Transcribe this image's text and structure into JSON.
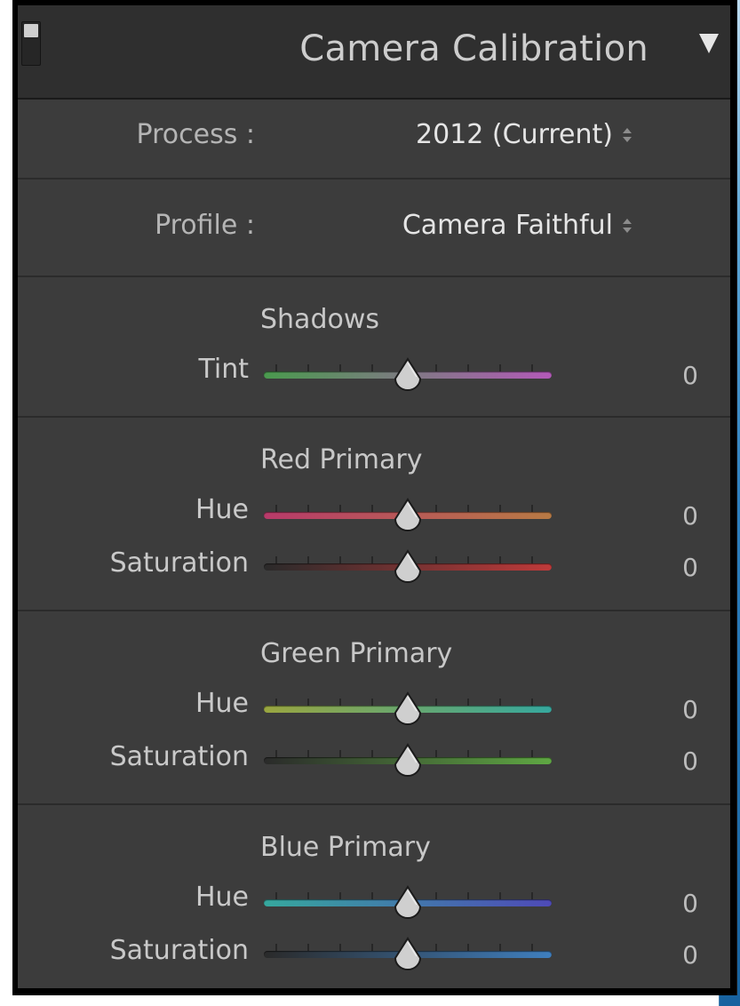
{
  "panel": {
    "title": "Camera Calibration",
    "process": {
      "label": "Process :",
      "value": "2012 (Current)"
    },
    "profile": {
      "label": "Profile :",
      "value": "Camera Faithful"
    }
  },
  "groups": [
    {
      "title": "Shadows",
      "sliders": [
        {
          "label": "Tint",
          "value": "0",
          "position": 0.5,
          "colors": [
            "#4a9a4e",
            "#b35ab8"
          ]
        }
      ]
    },
    {
      "title": "Red Primary",
      "sliders": [
        {
          "label": "Hue",
          "value": "0",
          "position": 0.5,
          "colors": [
            "#b83a6a",
            "#b87a44"
          ]
        },
        {
          "label": "Saturation",
          "value": "0",
          "position": 0.5,
          "colors": [
            "#2a2a2a",
            "#c03a3a"
          ]
        }
      ]
    },
    {
      "title": "Green Primary",
      "sliders": [
        {
          "label": "Hue",
          "value": "0",
          "position": 0.5,
          "colors": [
            "#9aa640",
            "#36a89e"
          ]
        },
        {
          "label": "Saturation",
          "value": "0",
          "position": 0.5,
          "colors": [
            "#2a2a2a",
            "#5fa843"
          ]
        }
      ]
    },
    {
      "title": "Blue Primary",
      "sliders": [
        {
          "label": "Hue",
          "value": "0",
          "position": 0.5,
          "colors": [
            "#36a89e",
            "#4e4ab8"
          ]
        },
        {
          "label": "Saturation",
          "value": "0",
          "position": 0.5,
          "colors": [
            "#2a2a2a",
            "#3f7fbf"
          ]
        }
      ]
    }
  ],
  "icons": {
    "panel_toggle": "panel-toggle-icon",
    "collapse": "triangle-down-icon",
    "stepper": "up-down-arrows-icon",
    "thumb": "slider-thumb-icon"
  }
}
